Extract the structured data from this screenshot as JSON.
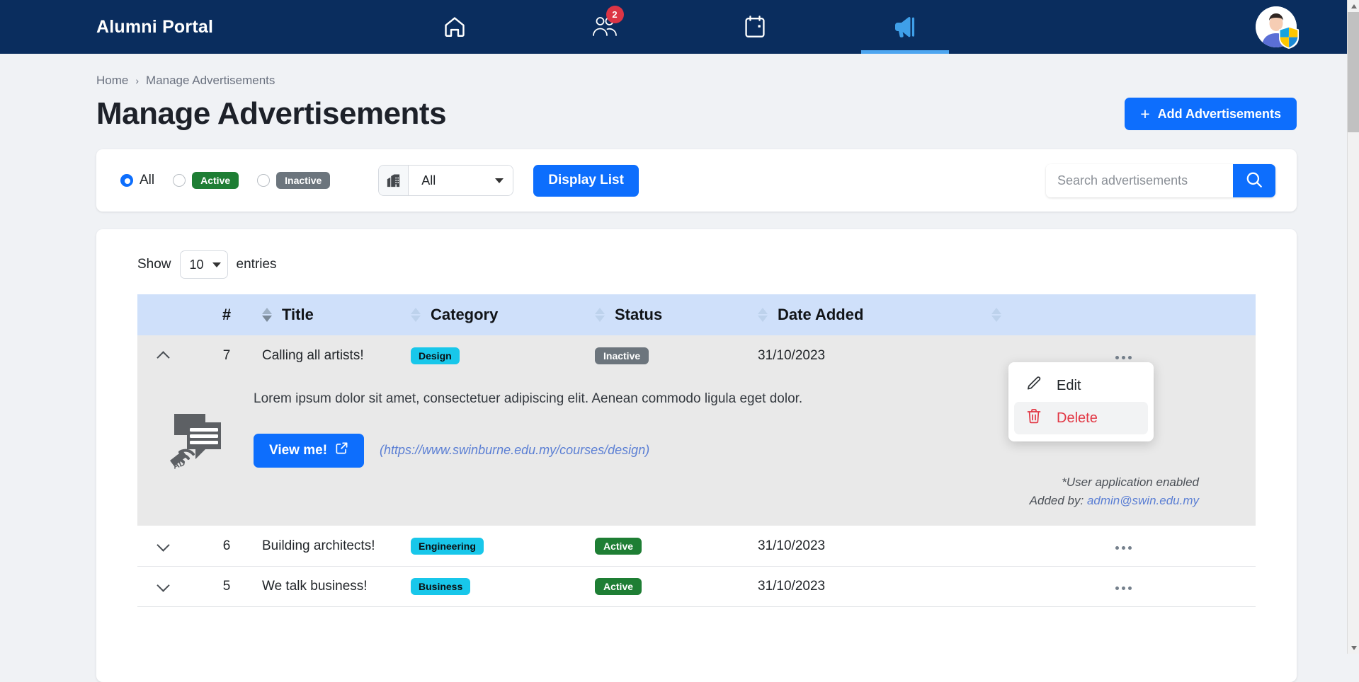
{
  "navbar": {
    "brand": "Alumni Portal",
    "items": [
      {
        "name": "home-icon",
        "label": "Home",
        "active": false,
        "badge": null
      },
      {
        "name": "people-icon",
        "label": "Alumni",
        "active": false,
        "badge": "2"
      },
      {
        "name": "calendar-icon",
        "label": "Events",
        "active": false,
        "badge": null
      },
      {
        "name": "megaphone-icon",
        "label": "Advertisements",
        "active": true,
        "badge": null
      }
    ],
    "avatar_label": "User profile",
    "accent": "#4ea6f0",
    "background": "#0a2d5e"
  },
  "breadcrumb": {
    "home": "Home",
    "separator": "›",
    "current": "Manage Advertisements"
  },
  "header": {
    "title": "Manage Advertisements",
    "add_button": "Add Advertisements",
    "add_button_icon": "+"
  },
  "filters": {
    "radios": [
      {
        "label": "All",
        "checked": true,
        "style": "text"
      },
      {
        "label": "Active",
        "checked": false,
        "style": "pill-active"
      },
      {
        "label": "Inactive",
        "checked": false,
        "style": "pill-inactive"
      }
    ],
    "school_select": {
      "icon": "building-icon",
      "value": "All"
    },
    "display_button": "Display List"
  },
  "search": {
    "placeholder": "Search advertisements",
    "value": "",
    "icon": "search-icon"
  },
  "table": {
    "show_label": "Show",
    "entries_value": "10",
    "entries_label": "entries",
    "columns": [
      {
        "key": "index",
        "label": "#",
        "sortable": false,
        "sorted": false
      },
      {
        "key": "title",
        "label": "Title",
        "sortable": true,
        "sorted": true
      },
      {
        "key": "category",
        "label": "Category",
        "sortable": true,
        "sorted": false
      },
      {
        "key": "status",
        "label": "Status",
        "sortable": true,
        "sorted": false
      },
      {
        "key": "date_added",
        "label": "Date Added",
        "sortable": true,
        "sorted": false
      },
      {
        "key": "actions",
        "label": "",
        "sortable": true,
        "sorted": false
      }
    ],
    "rows": [
      {
        "index": "7",
        "title": "Calling all artists!",
        "category": "Design",
        "status": "Inactive",
        "status_kind": "inactive",
        "date_added": "31/10/2023",
        "expanded": true,
        "detail": {
          "thumb_icon": "advertisement-icon",
          "description": "Lorem ipsum dolor sit amet, consectetuer adipiscing elit. Aenean commodo ligula eget dolor.",
          "view_button": "View me!",
          "url": "(https://www.swinburne.edu.my/courses/design)",
          "application_note": "*User application enabled",
          "added_by_label": "Added by:",
          "added_by_email": "admin@swin.edu.my"
        }
      },
      {
        "index": "6",
        "title": "Building architects!",
        "category": "Engineering",
        "status": "Active",
        "status_kind": "active",
        "date_added": "31/10/2023",
        "expanded": false
      },
      {
        "index": "5",
        "title": "We talk business!",
        "category": "Business",
        "status": "Active",
        "status_kind": "active",
        "date_added": "31/10/2023",
        "expanded": false
      }
    ]
  },
  "row_menu": {
    "visible": true,
    "items": [
      {
        "label": "Edit",
        "icon": "pencil-icon",
        "kind": "edit"
      },
      {
        "label": "Delete",
        "icon": "trash-icon",
        "kind": "delete",
        "hovered": true
      }
    ]
  },
  "colors": {
    "primary": "#0d6efd",
    "navy": "#0a2d5e",
    "category_badge": "#18c7ea",
    "status_active": "#1e7e34",
    "status_inactive": "#6c757d",
    "delete_red": "#e23744",
    "table_header": "#cfe0fa"
  }
}
